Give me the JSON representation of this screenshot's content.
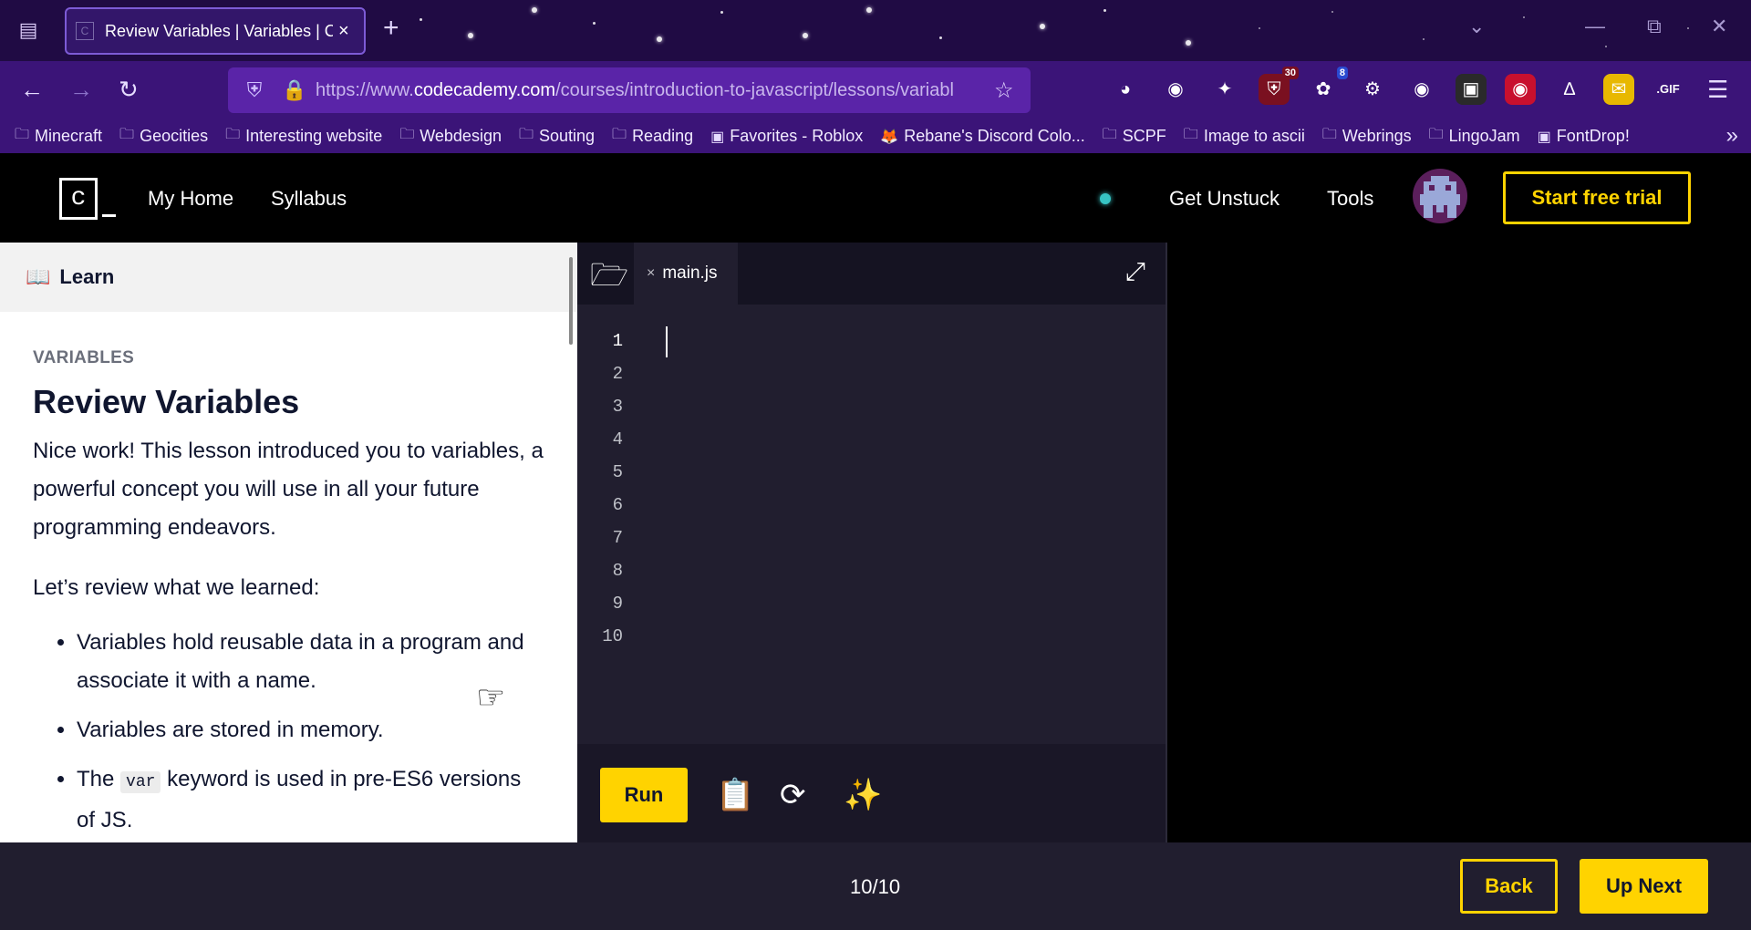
{
  "browser": {
    "tab_title": "Review Variables | Variables | Codecademy",
    "new_tab_label": "+",
    "url_base": "https://www.",
    "url_domain": "codecademy.com",
    "url_path": "/courses/introduction-to-javascript/lessons/variabl",
    "extensions": [
      {
        "name": "pocket-icon",
        "badge": ""
      },
      {
        "name": "avatar-extension-icon",
        "badge": ""
      },
      {
        "name": "puzzle-icon",
        "badge": ""
      },
      {
        "name": "ublock-icon",
        "badge": "30"
      },
      {
        "name": "ladybug-icon",
        "badge": "8"
      },
      {
        "name": "robot-icon",
        "badge": ""
      },
      {
        "name": "cookie-icon",
        "badge": ""
      },
      {
        "name": "ghost-icon",
        "badge": ""
      },
      {
        "name": "eye-icon",
        "badge": ""
      },
      {
        "name": "ds-icon",
        "badge": ""
      },
      {
        "name": "mail-icon",
        "badge": ""
      },
      {
        "name": "gif-icon",
        "badge": ".GIF"
      }
    ],
    "bookmarks": [
      {
        "label": "Minecraft",
        "icon": "folder-icon"
      },
      {
        "label": "Geocities",
        "icon": "folder-icon"
      },
      {
        "label": "Interesting website",
        "icon": "folder-icon"
      },
      {
        "label": "Webdesign",
        "icon": "folder-icon"
      },
      {
        "label": "Souting",
        "icon": "folder-icon"
      },
      {
        "label": "Reading",
        "icon": "folder-icon"
      },
      {
        "label": "Favorites - Roblox",
        "icon": "roblox-icon"
      },
      {
        "label": "Rebane's Discord Colo...",
        "icon": "fox-icon"
      },
      {
        "label": "SCPF",
        "icon": "folder-icon"
      },
      {
        "label": "Image to ascii",
        "icon": "folder-icon"
      },
      {
        "label": "Webrings",
        "icon": "folder-icon"
      },
      {
        "label": "LingoJam",
        "icon": "folder-icon"
      },
      {
        "label": "FontDrop!",
        "icon": "fontdrop-icon"
      }
    ]
  },
  "header": {
    "logo_letter": "c",
    "nav": [
      "My Home",
      "Syllabus"
    ],
    "get_unstuck": "Get Unstuck",
    "tools": "Tools",
    "trial": "Start free trial"
  },
  "lesson": {
    "panel_title": "Learn",
    "kicker": "VARIABLES",
    "title": "Review Variables",
    "intro": "Nice work! This lesson introduced you to variables, a powerful concept you will use in all your future programming endeavors.",
    "review": "Let’s review what we learned:",
    "points": [
      "Variables hold reusable data in a program and associate it with a name.",
      "Variables are stored in memory."
    ],
    "point3_pre": "The ",
    "point3_code": "var",
    "point3_post": " keyword is used in pre-ES6 versions of JS."
  },
  "editor": {
    "filename": "main.js",
    "line_numbers": [
      "1",
      "2",
      "3",
      "4",
      "5",
      "6",
      "7",
      "8",
      "9",
      "10"
    ],
    "run_label": "Run"
  },
  "footer": {
    "progress": "10/10",
    "back": "Back",
    "next": "Up Next"
  },
  "colors": {
    "accent": "#ffd300",
    "navy": "#10162f",
    "editor_bg": "#211e2f"
  }
}
